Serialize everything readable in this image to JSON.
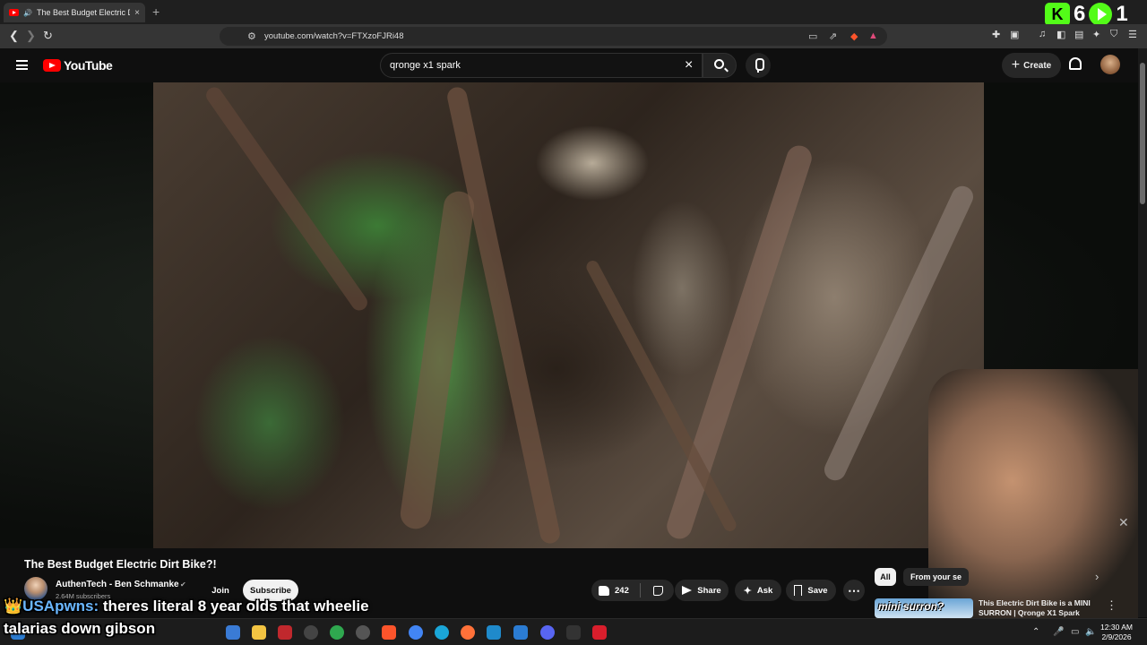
{
  "browser": {
    "tab_title": "The Best Budget Electric Dirt B",
    "tab_close": "×",
    "new_tab": "+",
    "url": "youtube.com/watch?v=FTXzoFJRi48",
    "overlay_counter_kick": "K",
    "overlay_counter_left": "6",
    "overlay_counter_right": "1"
  },
  "youtube": {
    "logo_text": "YouTube",
    "search_query": "qronge x1 spark",
    "clear_symbol": "×",
    "create_label": "Create",
    "create_plus": "+"
  },
  "video": {
    "title": "The Best Budget Electric Dirt Bike?!",
    "channel_name": "AuthenTech - Ben Schmanke",
    "verified_mark": "✔",
    "subscriber_count": "2.64M subscribers",
    "join_label": "Join",
    "subscribe_label": "Subscribe",
    "like_count": "242",
    "share_label": "Share",
    "ask_label": "Ask",
    "save_label": "Save",
    "more_symbol": "⋯"
  },
  "sidebar": {
    "chip_all": "All",
    "chip_from": "From your se",
    "recommendation_thumb_text": "mini surron?",
    "recommendation_title": "This Electric Dirt Bike is a MINI SURRON | Qronge X1 Spark"
  },
  "chat": {
    "crown": "👑",
    "username": "USApwns:",
    "message": " theres literal 8 year olds that wheelie talarias down gibson"
  },
  "taskbar": {
    "time": "12:30 AM",
    "date": "2/9/2026"
  },
  "colors": {
    "kick_green": "#53fc18",
    "youtube_red": "#ff0000",
    "chat_username": "#6ab7ff"
  }
}
